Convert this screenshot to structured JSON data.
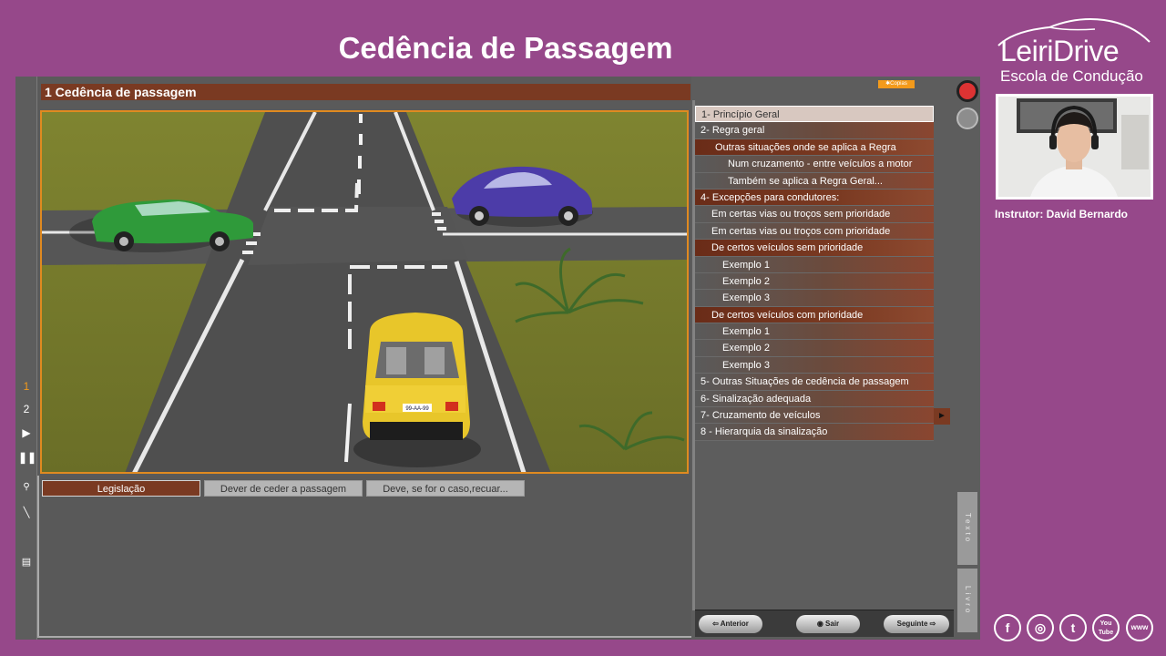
{
  "page": {
    "title": "Cedência de Passagem"
  },
  "brand": {
    "name": "LeiriDrive",
    "subtitle": "Escola de Condução",
    "instructor": "Instrutor: David Bernardo"
  },
  "lesson": {
    "header": "1 Cedência de passagem",
    "copias_label": "Copias",
    "tabs": [
      "Legislação",
      "Dever de ceder a passagem",
      "Deve, se for o caso,recuar..."
    ]
  },
  "left_controls": {
    "page1": "1",
    "page2": "2"
  },
  "menu": {
    "items": [
      "1- Princípio Geral",
      "2- Regra geral",
      "Outras situações onde se aplica a Regra",
      "Num cruzamento - entre veículos a motor",
      "Também se aplica a Regra Geral...",
      "4- Excepções para condutores:",
      "Em certas vias ou troços sem prioridade",
      "Em certas vias ou troços com prioridade",
      "De certos veículos sem prioridade",
      "Exemplo 1",
      "Exemplo 2",
      "Exemplo 3",
      "De certos veículos com prioridade",
      "Exemplo 1",
      "Exemplo 2",
      "Exemplo 3",
      "5- Outras Situações de cedência de passagem",
      "6- Sinalização adequada",
      "7- Cruzamento de veículos",
      "8 - Hierarquia da sinalização"
    ]
  },
  "side_tabs": {
    "texto": "Texto",
    "livro": "Livro"
  },
  "nav": {
    "prev": "Anterior",
    "exit": "Sair",
    "next": "Seguinte"
  },
  "scene": {
    "plate": "99-AA-99"
  },
  "social": {
    "facebook": "f",
    "instagram": "◎",
    "twitter": "t",
    "youtube": "You Tube",
    "web": "www"
  }
}
